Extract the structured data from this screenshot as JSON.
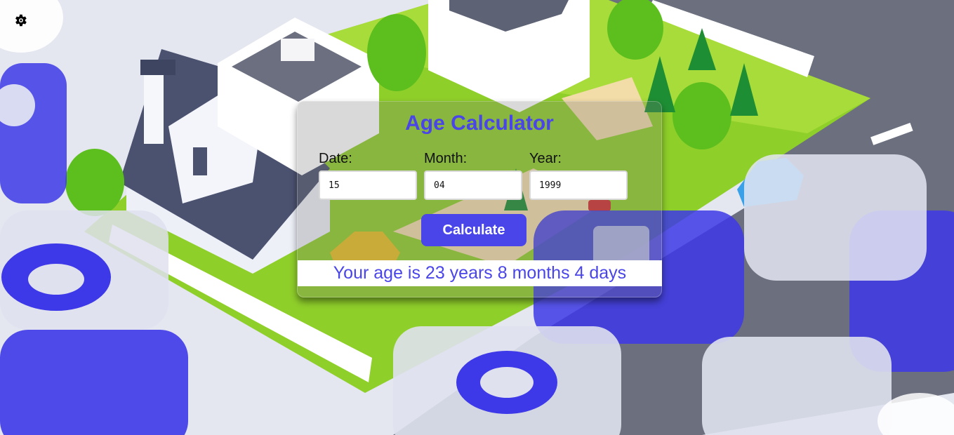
{
  "app": {
    "title": "Age Calculator"
  },
  "icons": {
    "settings": "gear-icon"
  },
  "colors": {
    "accent": "#4a45e8",
    "result_background": "#ffffff"
  },
  "form": {
    "date_label": "Date:",
    "date_value": "15",
    "month_label": "Month:",
    "month_value": "04",
    "year_label": "Year:",
    "year_value": "1999",
    "calculate_label": "Calculate"
  },
  "result": {
    "text": "Your age is 23 years 8 months 4 days"
  }
}
